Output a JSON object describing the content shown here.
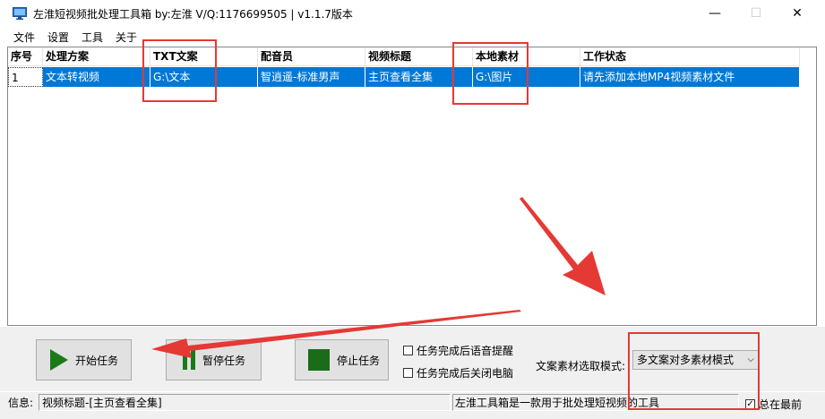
{
  "window": {
    "title": "左淮短视频批处理工具箱  by:左淮 V/Q:1176699505 | v1.1.7版本",
    "minimize_glyph": "—",
    "maximize_glyph": "☐",
    "close_glyph": "✕"
  },
  "menu": {
    "items": [
      "文件",
      "设置",
      "工具",
      "关于"
    ]
  },
  "table": {
    "columns": [
      "序号",
      "处理方案",
      "TXT文案",
      "配音员",
      "视频标题",
      "本地素材",
      "工作状态"
    ],
    "rows": [
      [
        "1",
        "文本转视频",
        "G:\\文本",
        "智逍遥-标准男声",
        "主页查看全集",
        "G:\\图片",
        "请先添加本地MP4视频素材文件"
      ]
    ]
  },
  "controls": {
    "start_label": "开始任务",
    "pause_label": "暂停任务",
    "stop_label": "停止任务",
    "checkbox_voice_label": "任务完成后语音提醒",
    "checkbox_shutdown_label": "任务完成后关闭电脑",
    "mode_label": "文案素材选取模式:",
    "mode_value": "多文案对多素材模式",
    "dropdown_arrow": "⌵"
  },
  "status": {
    "info_label": "信息:",
    "info_text": "视频标题-[主页查看全集]",
    "tool_description": "左淮工具箱是一款用于批处理短视频的工具",
    "always_on_top_label": "总在最前",
    "always_on_top_checked": true,
    "check_glyph": "✓"
  },
  "colors": {
    "selection": "#0078d7",
    "highlight_red": "#e53935",
    "play_green": "#1a7a1a"
  }
}
